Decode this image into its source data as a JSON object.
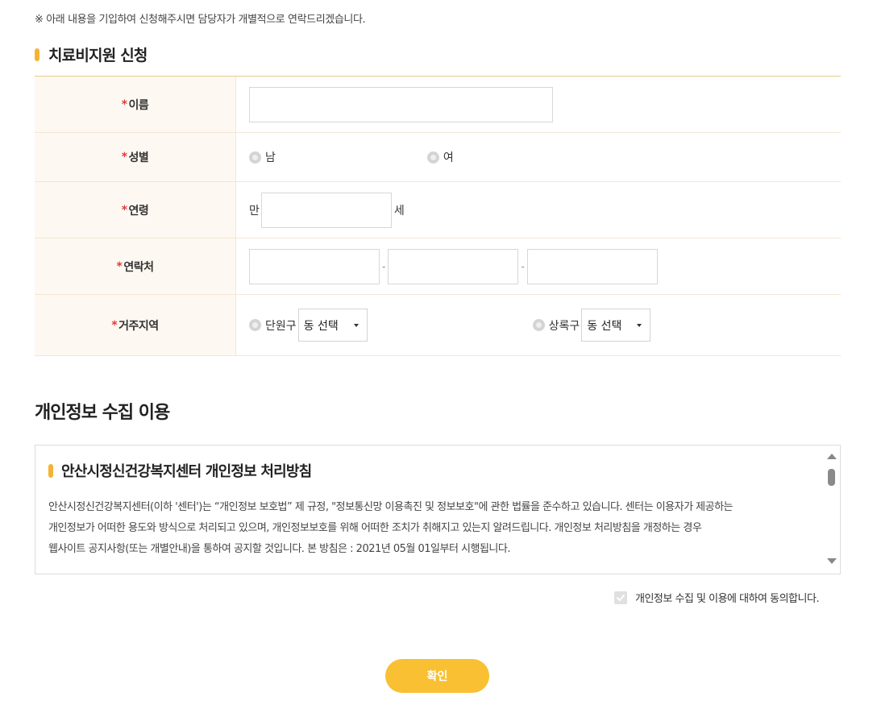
{
  "notice": "※ 아래 내용을 기입하여 신청해주시면 담당자가 개별적으로 연락드리겠습니다.",
  "section_title": "치료비지원 신청",
  "form": {
    "required_mark": "*",
    "name_label": "이름",
    "gender_label": "성별",
    "gender_male": "남",
    "gender_female": "여",
    "age_label": "연령",
    "age_prefix": "만",
    "age_suffix": "세",
    "contact_label": "연락처",
    "dash": "-",
    "region_label": "거주지역",
    "region_danwon": "단원구",
    "region_sangnok": "상록구",
    "dong_select_placeholder": "동 선택"
  },
  "privacy": {
    "heading": "개인정보 수집 이용",
    "policy_title": "안산시정신건강복지센터 개인정보 처리방침",
    "policy_text_1": "안산시정신건강복지센터(이하 '센터')는 “개인정보 보호법” 제 규정, \"정보통신망 이용촉진 및 정보보호\"에 관한 법률을 준수하고 있습니다. 센터는 이용자가 제공하는",
    "policy_text_2": "개인정보가 어떠한 용도와 방식으로 처리되고 있으며, 개인정보보호를 위해 어떠한 조치가 취해지고 있는지 알려드립니다. 개인정보 처리방침을 개정하는 경우",
    "policy_text_3": "웹사이트 공지사항(또는 개별안내)을 통하여 공지할 것입니다. 본 방침은 : 2021년 05월 01일부터 시행됩니다.",
    "agree_label": "개인정보 수집 및 이용에 대하여 동의합니다."
  },
  "confirm_button": "확인",
  "colors": {
    "accent": "#f8c032",
    "required": "#e03b3b",
    "label_bg": "#fef8f2"
  }
}
